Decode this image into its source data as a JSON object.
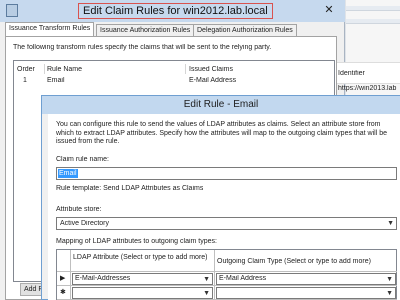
{
  "outer_dialog": {
    "title": "Edit Claim Rules for win2012.lab.local",
    "close_glyph": "✕",
    "tabs": [
      "Issuance Transform Rules",
      "Issuance Authorization Rules",
      "Delegation Authorization Rules"
    ],
    "description": "The following transform rules specify the claims that will be sent to the relying party.",
    "list_headers": [
      "Order",
      "Rule Name",
      "Issued Claims"
    ],
    "rows": [
      {
        "order": "1",
        "rule_name": "Email",
        "issued_claims": "E-Mail Address"
      }
    ],
    "add_rule_label": "Add R"
  },
  "right_window": {
    "column_header": "Identifier",
    "identifier_value": "https://win2013.lab"
  },
  "edit_rule_dialog": {
    "title": "Edit Rule - Email",
    "intro": "You can configure this rule to send the values of LDAP attributes as claims. Select an attribute store from which to extract LDAP attributes. Specify how the attributes will map to the outgoing claim types that will be issued from the rule.",
    "claim_rule_name_label": "Claim rule name:",
    "claim_rule_name_value": "Email",
    "rule_template": "Rule template: Send LDAP Attributes as Claims",
    "attribute_store_label": "Attribute store:",
    "attribute_store_value": "Active Directory",
    "mapping_label": "Mapping of LDAP attributes to outgoing claim types:",
    "mapping_headers": {
      "ldap": "LDAP Attribute (Select or type to add more)",
      "claim": "Outgoing Claim Type (Select or type to add more)"
    },
    "mapping_rows": [
      {
        "marker": "▶",
        "ldap": "E-Mail-Addresses",
        "claim": "E-Mail Address"
      },
      {
        "marker": "✱",
        "ldap": "",
        "claim": ""
      }
    ]
  },
  "colors": {
    "title_bar": "#c2d8ef",
    "selection": "#3399ff",
    "highlight_border": "#d9534f"
  }
}
